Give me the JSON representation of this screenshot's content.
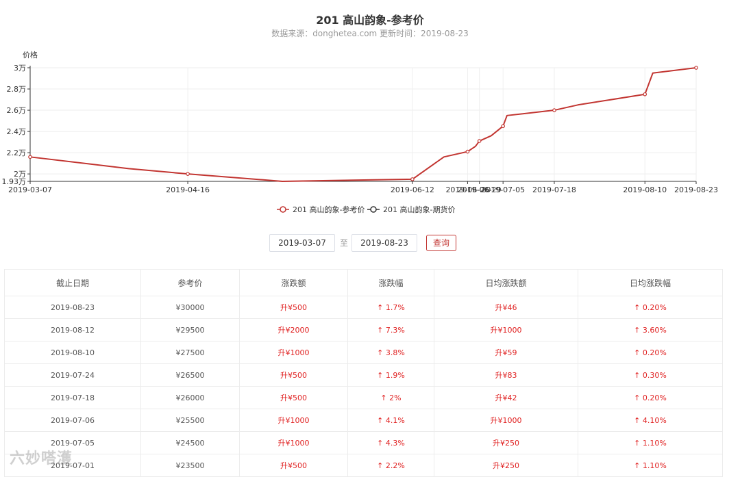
{
  "header": {
    "title": "201 高山韵象-参考价",
    "subtitle": "数据来源：donghetea.com 更新时间：2019-08-23"
  },
  "chart_data": {
    "type": "line",
    "ylabel": "价格",
    "ylim": [
      19300,
      30000
    ],
    "yticks": [
      {
        "value": 30000,
        "label": "3万"
      },
      {
        "value": 28000,
        "label": "2.8万"
      },
      {
        "value": 26000,
        "label": "2.6万"
      },
      {
        "value": 24000,
        "label": "2.4万"
      },
      {
        "value": 22000,
        "label": "2.2万"
      },
      {
        "value": 20000,
        "label": "2万"
      },
      {
        "value": 19300,
        "label": "1.93万"
      }
    ],
    "x": [
      "2019-03-07",
      "2019-04-01",
      "2019-04-16",
      "2019-05-10",
      "2019-06-12",
      "2019-06-20",
      "2019-06-26",
      "2019-06-28",
      "2019-06-29",
      "2019-07-02",
      "2019-07-05",
      "2019-07-06",
      "2019-07-18",
      "2019-07-24",
      "2019-08-10",
      "2019-08-12",
      "2019-08-23"
    ],
    "xticks": [
      "2019-03-07",
      "2019-04-16",
      "2019-06-12",
      "2019-06-26",
      "2019-06-29",
      "2019-07-05",
      "2019-07-18",
      "2019-08-10",
      "2019-08-23"
    ],
    "series": [
      {
        "name": "201 高山韵象-参考价",
        "color": "#c23531",
        "values": [
          21600,
          20500,
          20000,
          19300,
          19500,
          21600,
          22100,
          22600,
          23100,
          23600,
          24500,
          25500,
          26000,
          26500,
          27500,
          29500,
          30000
        ]
      },
      {
        "name": "201 高山韵象-期货价",
        "color": "#333333",
        "values": []
      }
    ],
    "grid": true,
    "legend": "bottom-center"
  },
  "controls": {
    "start_date": "2019-03-07",
    "end_date": "2019-08-23",
    "to_label": "至",
    "query_label": "查询"
  },
  "table": {
    "columns": [
      "截止日期",
      "参考价",
      "涨跌额",
      "涨跌幅",
      "日均涨跌额",
      "日均涨跌幅"
    ],
    "rows": [
      [
        "2019-08-23",
        "¥30000",
        "升¥500",
        "↑ 1.7%",
        "升¥46",
        "↑ 0.20%"
      ],
      [
        "2019-08-12",
        "¥29500",
        "升¥2000",
        "↑ 7.3%",
        "升¥1000",
        "↑ 3.60%"
      ],
      [
        "2019-08-10",
        "¥27500",
        "升¥1000",
        "↑ 3.8%",
        "升¥59",
        "↑ 0.20%"
      ],
      [
        "2019-07-24",
        "¥26500",
        "升¥500",
        "↑ 1.9%",
        "升¥83",
        "↑ 0.30%"
      ],
      [
        "2019-07-18",
        "¥26000",
        "升¥500",
        "↑ 2%",
        "升¥42",
        "↑ 0.20%"
      ],
      [
        "2019-07-06",
        "¥25500",
        "升¥1000",
        "↑ 4.1%",
        "升¥1000",
        "↑ 4.10%"
      ],
      [
        "2019-07-05",
        "¥24500",
        "升¥1000",
        "↑ 4.3%",
        "升¥250",
        "↑ 1.10%"
      ],
      [
        "2019-07-01",
        "¥23500",
        "升¥500",
        "↑ 2.2%",
        "升¥250",
        "↑ 1.10%"
      ]
    ]
  },
  "watermark": "六妙嗒濩"
}
